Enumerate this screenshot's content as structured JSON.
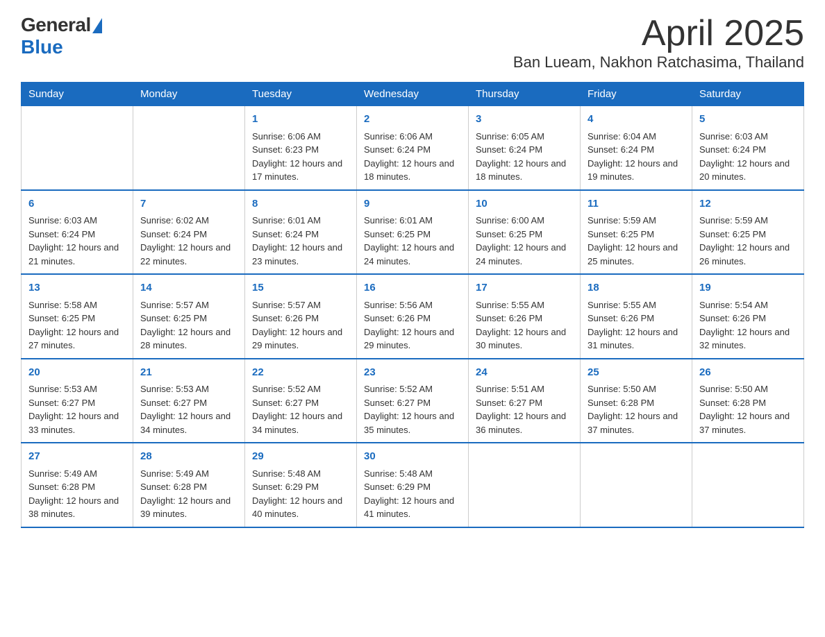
{
  "logo": {
    "text_general": "General",
    "text_blue": "Blue"
  },
  "title": "April 2025",
  "subtitle": "Ban Lueam, Nakhon Ratchasima, Thailand",
  "days_of_week": [
    "Sunday",
    "Monday",
    "Tuesday",
    "Wednesday",
    "Thursday",
    "Friday",
    "Saturday"
  ],
  "weeks": [
    [
      {
        "day": "",
        "sunrise": "",
        "sunset": "",
        "daylight": ""
      },
      {
        "day": "",
        "sunrise": "",
        "sunset": "",
        "daylight": ""
      },
      {
        "day": "1",
        "sunrise": "Sunrise: 6:06 AM",
        "sunset": "Sunset: 6:23 PM",
        "daylight": "Daylight: 12 hours and 17 minutes."
      },
      {
        "day": "2",
        "sunrise": "Sunrise: 6:06 AM",
        "sunset": "Sunset: 6:24 PM",
        "daylight": "Daylight: 12 hours and 18 minutes."
      },
      {
        "day": "3",
        "sunrise": "Sunrise: 6:05 AM",
        "sunset": "Sunset: 6:24 PM",
        "daylight": "Daylight: 12 hours and 18 minutes."
      },
      {
        "day": "4",
        "sunrise": "Sunrise: 6:04 AM",
        "sunset": "Sunset: 6:24 PM",
        "daylight": "Daylight: 12 hours and 19 minutes."
      },
      {
        "day": "5",
        "sunrise": "Sunrise: 6:03 AM",
        "sunset": "Sunset: 6:24 PM",
        "daylight": "Daylight: 12 hours and 20 minutes."
      }
    ],
    [
      {
        "day": "6",
        "sunrise": "Sunrise: 6:03 AM",
        "sunset": "Sunset: 6:24 PM",
        "daylight": "Daylight: 12 hours and 21 minutes."
      },
      {
        "day": "7",
        "sunrise": "Sunrise: 6:02 AM",
        "sunset": "Sunset: 6:24 PM",
        "daylight": "Daylight: 12 hours and 22 minutes."
      },
      {
        "day": "8",
        "sunrise": "Sunrise: 6:01 AM",
        "sunset": "Sunset: 6:24 PM",
        "daylight": "Daylight: 12 hours and 23 minutes."
      },
      {
        "day": "9",
        "sunrise": "Sunrise: 6:01 AM",
        "sunset": "Sunset: 6:25 PM",
        "daylight": "Daylight: 12 hours and 24 minutes."
      },
      {
        "day": "10",
        "sunrise": "Sunrise: 6:00 AM",
        "sunset": "Sunset: 6:25 PM",
        "daylight": "Daylight: 12 hours and 24 minutes."
      },
      {
        "day": "11",
        "sunrise": "Sunrise: 5:59 AM",
        "sunset": "Sunset: 6:25 PM",
        "daylight": "Daylight: 12 hours and 25 minutes."
      },
      {
        "day": "12",
        "sunrise": "Sunrise: 5:59 AM",
        "sunset": "Sunset: 6:25 PM",
        "daylight": "Daylight: 12 hours and 26 minutes."
      }
    ],
    [
      {
        "day": "13",
        "sunrise": "Sunrise: 5:58 AM",
        "sunset": "Sunset: 6:25 PM",
        "daylight": "Daylight: 12 hours and 27 minutes."
      },
      {
        "day": "14",
        "sunrise": "Sunrise: 5:57 AM",
        "sunset": "Sunset: 6:25 PM",
        "daylight": "Daylight: 12 hours and 28 minutes."
      },
      {
        "day": "15",
        "sunrise": "Sunrise: 5:57 AM",
        "sunset": "Sunset: 6:26 PM",
        "daylight": "Daylight: 12 hours and 29 minutes."
      },
      {
        "day": "16",
        "sunrise": "Sunrise: 5:56 AM",
        "sunset": "Sunset: 6:26 PM",
        "daylight": "Daylight: 12 hours and 29 minutes."
      },
      {
        "day": "17",
        "sunrise": "Sunrise: 5:55 AM",
        "sunset": "Sunset: 6:26 PM",
        "daylight": "Daylight: 12 hours and 30 minutes."
      },
      {
        "day": "18",
        "sunrise": "Sunrise: 5:55 AM",
        "sunset": "Sunset: 6:26 PM",
        "daylight": "Daylight: 12 hours and 31 minutes."
      },
      {
        "day": "19",
        "sunrise": "Sunrise: 5:54 AM",
        "sunset": "Sunset: 6:26 PM",
        "daylight": "Daylight: 12 hours and 32 minutes."
      }
    ],
    [
      {
        "day": "20",
        "sunrise": "Sunrise: 5:53 AM",
        "sunset": "Sunset: 6:27 PM",
        "daylight": "Daylight: 12 hours and 33 minutes."
      },
      {
        "day": "21",
        "sunrise": "Sunrise: 5:53 AM",
        "sunset": "Sunset: 6:27 PM",
        "daylight": "Daylight: 12 hours and 34 minutes."
      },
      {
        "day": "22",
        "sunrise": "Sunrise: 5:52 AM",
        "sunset": "Sunset: 6:27 PM",
        "daylight": "Daylight: 12 hours and 34 minutes."
      },
      {
        "day": "23",
        "sunrise": "Sunrise: 5:52 AM",
        "sunset": "Sunset: 6:27 PM",
        "daylight": "Daylight: 12 hours and 35 minutes."
      },
      {
        "day": "24",
        "sunrise": "Sunrise: 5:51 AM",
        "sunset": "Sunset: 6:27 PM",
        "daylight": "Daylight: 12 hours and 36 minutes."
      },
      {
        "day": "25",
        "sunrise": "Sunrise: 5:50 AM",
        "sunset": "Sunset: 6:28 PM",
        "daylight": "Daylight: 12 hours and 37 minutes."
      },
      {
        "day": "26",
        "sunrise": "Sunrise: 5:50 AM",
        "sunset": "Sunset: 6:28 PM",
        "daylight": "Daylight: 12 hours and 37 minutes."
      }
    ],
    [
      {
        "day": "27",
        "sunrise": "Sunrise: 5:49 AM",
        "sunset": "Sunset: 6:28 PM",
        "daylight": "Daylight: 12 hours and 38 minutes."
      },
      {
        "day": "28",
        "sunrise": "Sunrise: 5:49 AM",
        "sunset": "Sunset: 6:28 PM",
        "daylight": "Daylight: 12 hours and 39 minutes."
      },
      {
        "day": "29",
        "sunrise": "Sunrise: 5:48 AM",
        "sunset": "Sunset: 6:29 PM",
        "daylight": "Daylight: 12 hours and 40 minutes."
      },
      {
        "day": "30",
        "sunrise": "Sunrise: 5:48 AM",
        "sunset": "Sunset: 6:29 PM",
        "daylight": "Daylight: 12 hours and 41 minutes."
      },
      {
        "day": "",
        "sunrise": "",
        "sunset": "",
        "daylight": ""
      },
      {
        "day": "",
        "sunrise": "",
        "sunset": "",
        "daylight": ""
      },
      {
        "day": "",
        "sunrise": "",
        "sunset": "",
        "daylight": ""
      }
    ]
  ]
}
